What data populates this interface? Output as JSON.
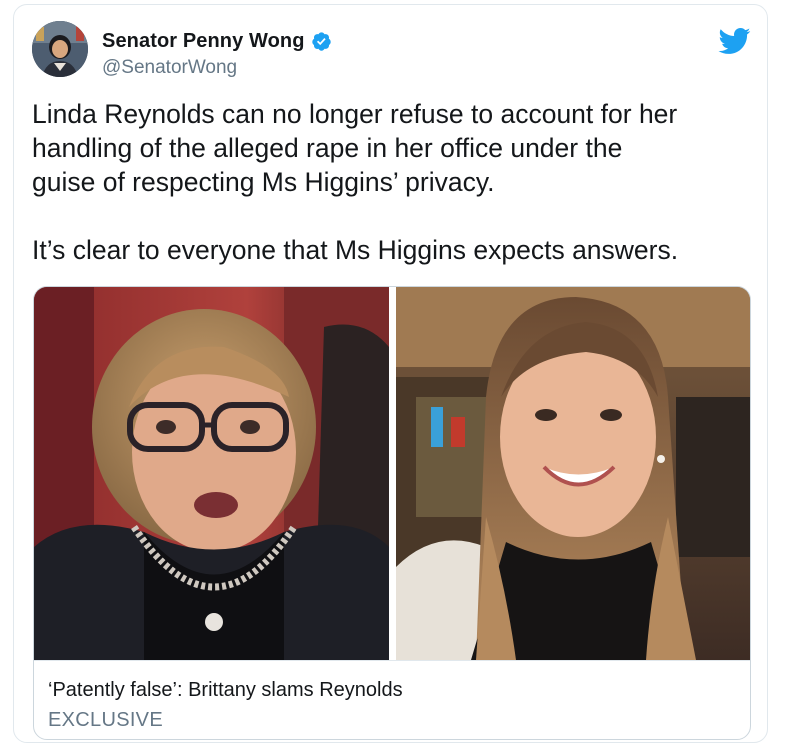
{
  "tweet": {
    "author": {
      "display_name": "Senator Penny Wong",
      "handle": "@SenatorWong",
      "verified": true,
      "avatar_icon": "avatar"
    },
    "text": "Linda Reynolds can no longer refuse to account for her\nhandling of the alleged rape in her office under the\nguise of respecting Ms Higgins’ privacy.\n\nIt’s clear to everyone that Ms Higgins expects answers.",
    "logo_icon": "twitter-bird-icon",
    "card": {
      "images": [
        "photo-woman-speaking-senate",
        "photo-woman-smiling"
      ],
      "title": "‘Patently false’: Brittany slams Reynolds",
      "tag": "EXCLUSIVE"
    }
  },
  "colors": {
    "twitter_blue": "#1da1f2",
    "text_primary": "#14171a",
    "text_secondary": "#657786",
    "border": "#e1e8ed"
  }
}
